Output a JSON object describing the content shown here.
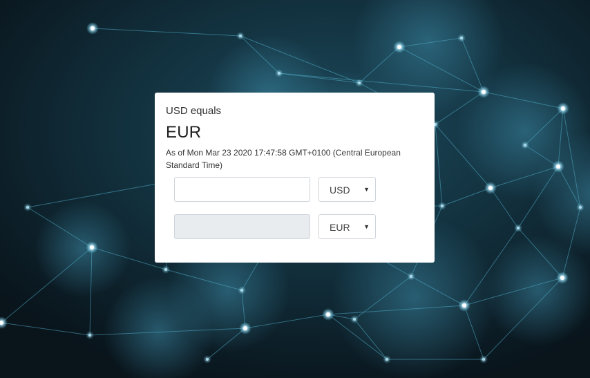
{
  "converter": {
    "subtitle": "USD equals",
    "result": "EUR",
    "as_of": "As of Mon Mar 23 2020 17:47:58 GMT+0100 (Central European Standard Time)",
    "from": {
      "amount": "",
      "currency": "USD"
    },
    "to": {
      "amount": "",
      "currency": "EUR"
    }
  },
  "icons": {
    "dropdown": "chevron-down-icon"
  },
  "colors": {
    "background": "#0b1820",
    "network": "#4fa9c4",
    "card": "#ffffff",
    "disabled_field": "#e9ecef"
  }
}
